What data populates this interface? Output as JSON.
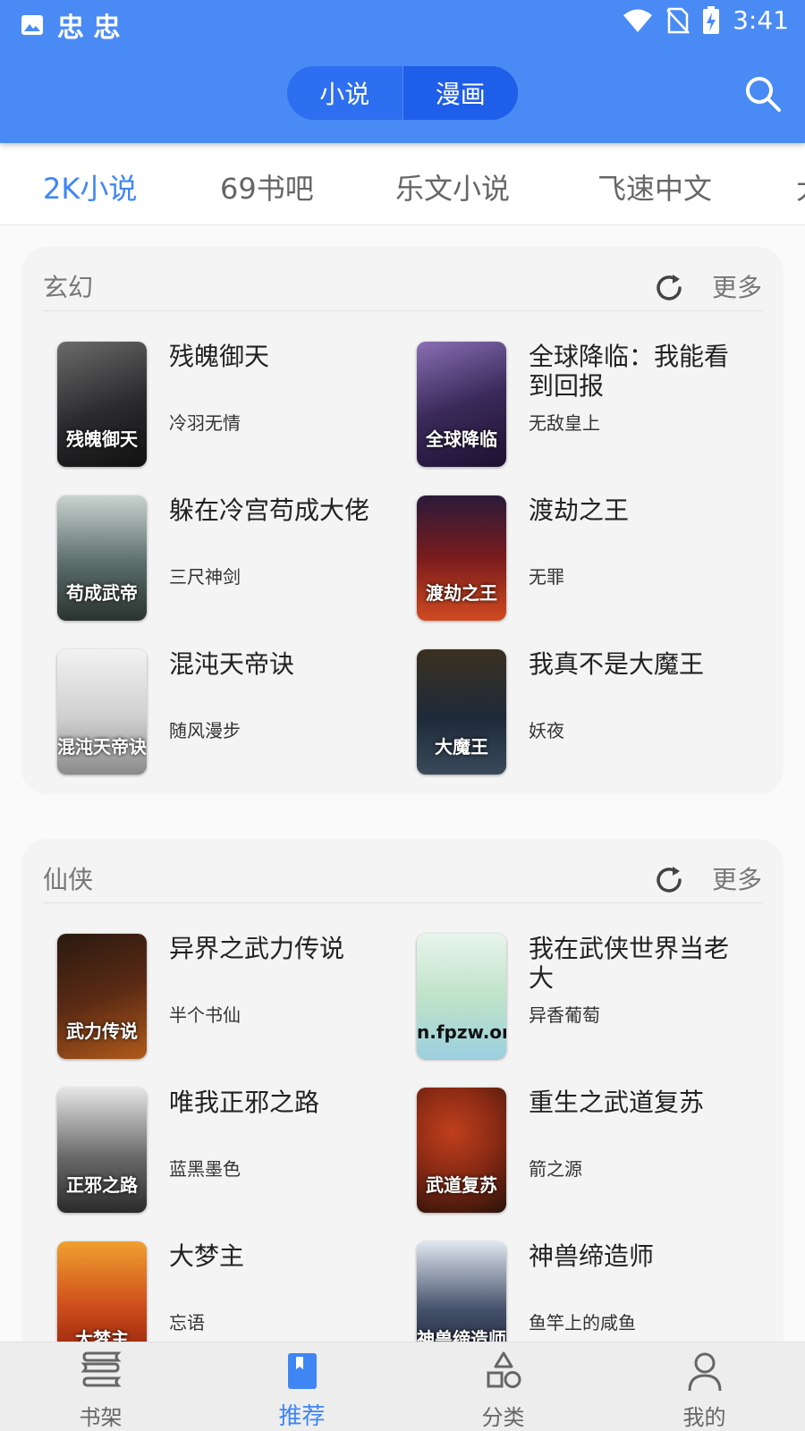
{
  "statusbar": {
    "app_glyphs": "忠 忠",
    "time": "3:41"
  },
  "header": {
    "tabs": [
      "小说",
      "漫画"
    ],
    "search_icon": "search-icon"
  },
  "sources": [
    "2K小说",
    "69书吧",
    "乐文小说",
    "飞速中文",
    "大"
  ],
  "sections": [
    {
      "title": "玄幻",
      "more_label": "更多",
      "books": [
        {
          "title": "残魄御天",
          "author": "冷羽无情",
          "cover_text": "残魄御天",
          "cover_color": "#2b2a2c"
        },
        {
          "title": "全球降临：我能看到回报",
          "author": "无敌皇上",
          "cover_text": "全球降临",
          "cover_color": "#3a2a5a"
        },
        {
          "title": "躲在冷宫苟成大佬",
          "author": "三尺神剑",
          "cover_text": "苟成武帝",
          "cover_color": "#5a6b68"
        },
        {
          "title": "渡劫之王",
          "author": "无罪",
          "cover_text": "渡劫之王",
          "cover_color": "#7a1c1c"
        },
        {
          "title": "混沌天帝诀",
          "author": "随风漫步",
          "cover_text": "混沌天帝诀",
          "cover_color": "#cfcfcf"
        },
        {
          "title": "我真不是大魔王",
          "author": "妖夜",
          "cover_text": "大魔王",
          "cover_color": "#1e2a3a"
        }
      ]
    },
    {
      "title": "仙侠",
      "more_label": "更多",
      "books": [
        {
          "title": "异界之武力传说",
          "author": "半个书仙",
          "cover_text": "武力传说",
          "cover_color": "#5a2a14"
        },
        {
          "title": "我在武侠世界当老大",
          "author": "异香葡萄",
          "cover_text": "n.fpzw.org",
          "cover_color": "#bfe3c9"
        },
        {
          "title": "唯我正邪之路",
          "author": "蓝黑墨色",
          "cover_text": "正邪之路",
          "cover_color": "#6a6a6a"
        },
        {
          "title": "重生之武道复苏",
          "author": "箭之源",
          "cover_text": "武道复苏",
          "cover_color": "#8a2a14"
        },
        {
          "title": "大梦主",
          "author": "忘语",
          "cover_text": "大梦主",
          "cover_color": "#d0501c"
        },
        {
          "title": "神兽缔造师",
          "author": "鱼竿上的咸鱼",
          "cover_text": "神兽缔造师",
          "cover_color": "#44506a"
        }
      ]
    }
  ],
  "bottom_nav": [
    {
      "label": "书架",
      "icon": "bookshelf-icon"
    },
    {
      "label": "推荐",
      "icon": "bookmark-icon"
    },
    {
      "label": "分类",
      "icon": "category-icon"
    },
    {
      "label": "我的",
      "icon": "person-icon"
    }
  ],
  "colors": {
    "primary": "#4a8af4",
    "accent": "#3f86f4",
    "segment_bg": "#2d6ff0"
  }
}
